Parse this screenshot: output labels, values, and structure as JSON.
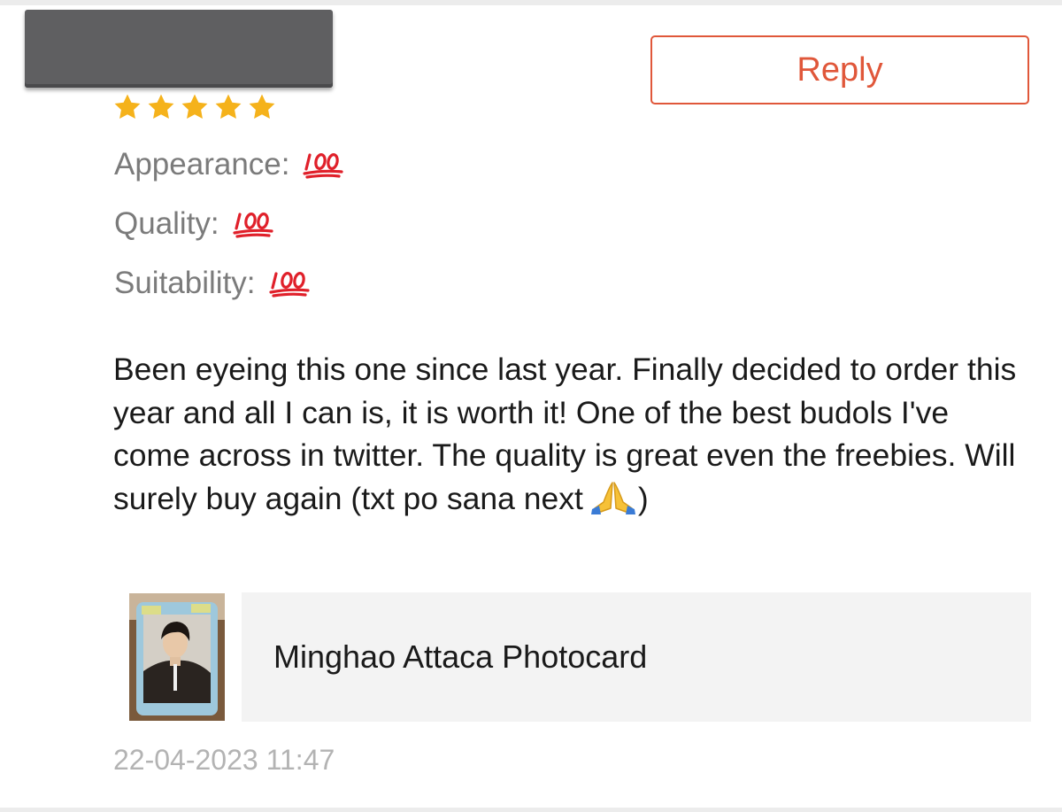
{
  "review": {
    "reply_label": "Reply",
    "star_rating": 5,
    "star_color": "#f5b21b",
    "ratings": [
      {
        "label": "Appearance:",
        "value_icon": "hundred-points-icon"
      },
      {
        "label": "Quality:",
        "value_icon": "hundred-points-icon"
      },
      {
        "label": "Suitability:",
        "value_icon": "hundred-points-icon"
      }
    ],
    "body_text": "Been eyeing this one since last year. Finally decided to order this year and all I can is, it is worth it! One of the best budols I've come across in twitter. The quality is great even the freebies. Will surely buy again (txt po sana next",
    "body_end_icon": "folded-hands-icon",
    "body_closing": ")",
    "product": {
      "name": "Minghao Attaca Photocard",
      "thumbnail_icon": "photocard-thumbnail"
    },
    "timestamp": "22-04-2023 11:47"
  },
  "colors": {
    "accent": "#e0573a",
    "label_gray": "#7b7b7b",
    "timestamp_gray": "#b3b3b3",
    "card_background": "#f3f3f3"
  }
}
